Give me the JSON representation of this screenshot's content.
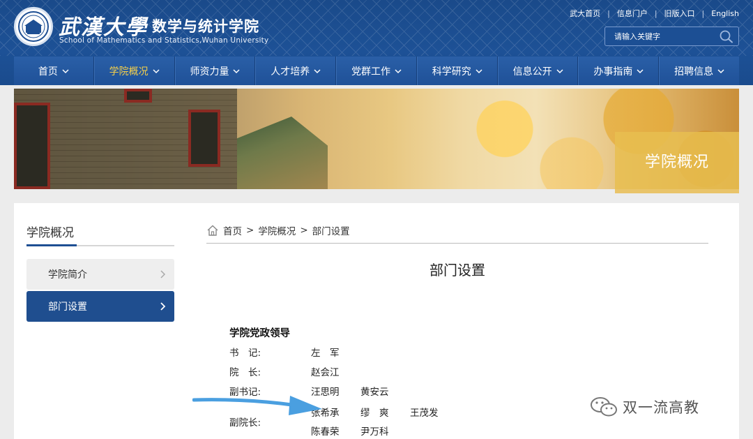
{
  "header": {
    "logo_calligraphy": "武漢大學",
    "school_name": "数学与统计学院",
    "school_name_en": "School of Mathematics and Statistics,Wuhan University",
    "top_links": [
      "武大首页",
      "信息门户",
      "旧版入口",
      "English"
    ],
    "search_placeholder": "请输入关键字"
  },
  "nav": {
    "items": [
      {
        "label": "首页"
      },
      {
        "label": "学院概况"
      },
      {
        "label": "师资力量"
      },
      {
        "label": "人才培养"
      },
      {
        "label": "党群工作"
      },
      {
        "label": "科学研究"
      },
      {
        "label": "信息公开"
      },
      {
        "label": "办事指南"
      },
      {
        "label": "招聘信息"
      }
    ],
    "active_index": 1
  },
  "banner": {
    "label": "学院概况"
  },
  "sidebar": {
    "title": "学院概况",
    "items": [
      {
        "label": "学院简介"
      },
      {
        "label": "部门设置"
      }
    ],
    "active_index": 1
  },
  "breadcrumb": {
    "home": "首页",
    "level1": "学院概况",
    "level2": "部门设置",
    "separator": ">"
  },
  "main": {
    "title": "部门设置",
    "section_heading": "学院党政领导",
    "rows": [
      {
        "label": "书　记:",
        "names": [
          "左　军"
        ]
      },
      {
        "label": "院　长:",
        "names": [
          "赵会江"
        ]
      },
      {
        "label": "副书记:",
        "names": [
          "汪思明",
          "黄安云"
        ]
      },
      {
        "label": "副院长:",
        "names": [
          "张希承",
          "缪　爽",
          "王茂发",
          "陈春荣",
          "尹万科"
        ]
      }
    ]
  },
  "watermark": {
    "text": "双一流高教"
  },
  "colors": {
    "header_blue": "#1d5196",
    "nav_active": "#f6d04a",
    "sidebar_active": "#1f4e8f",
    "annotation_arrow": "#4a9fe0",
    "banner_label": "#e8be50"
  }
}
